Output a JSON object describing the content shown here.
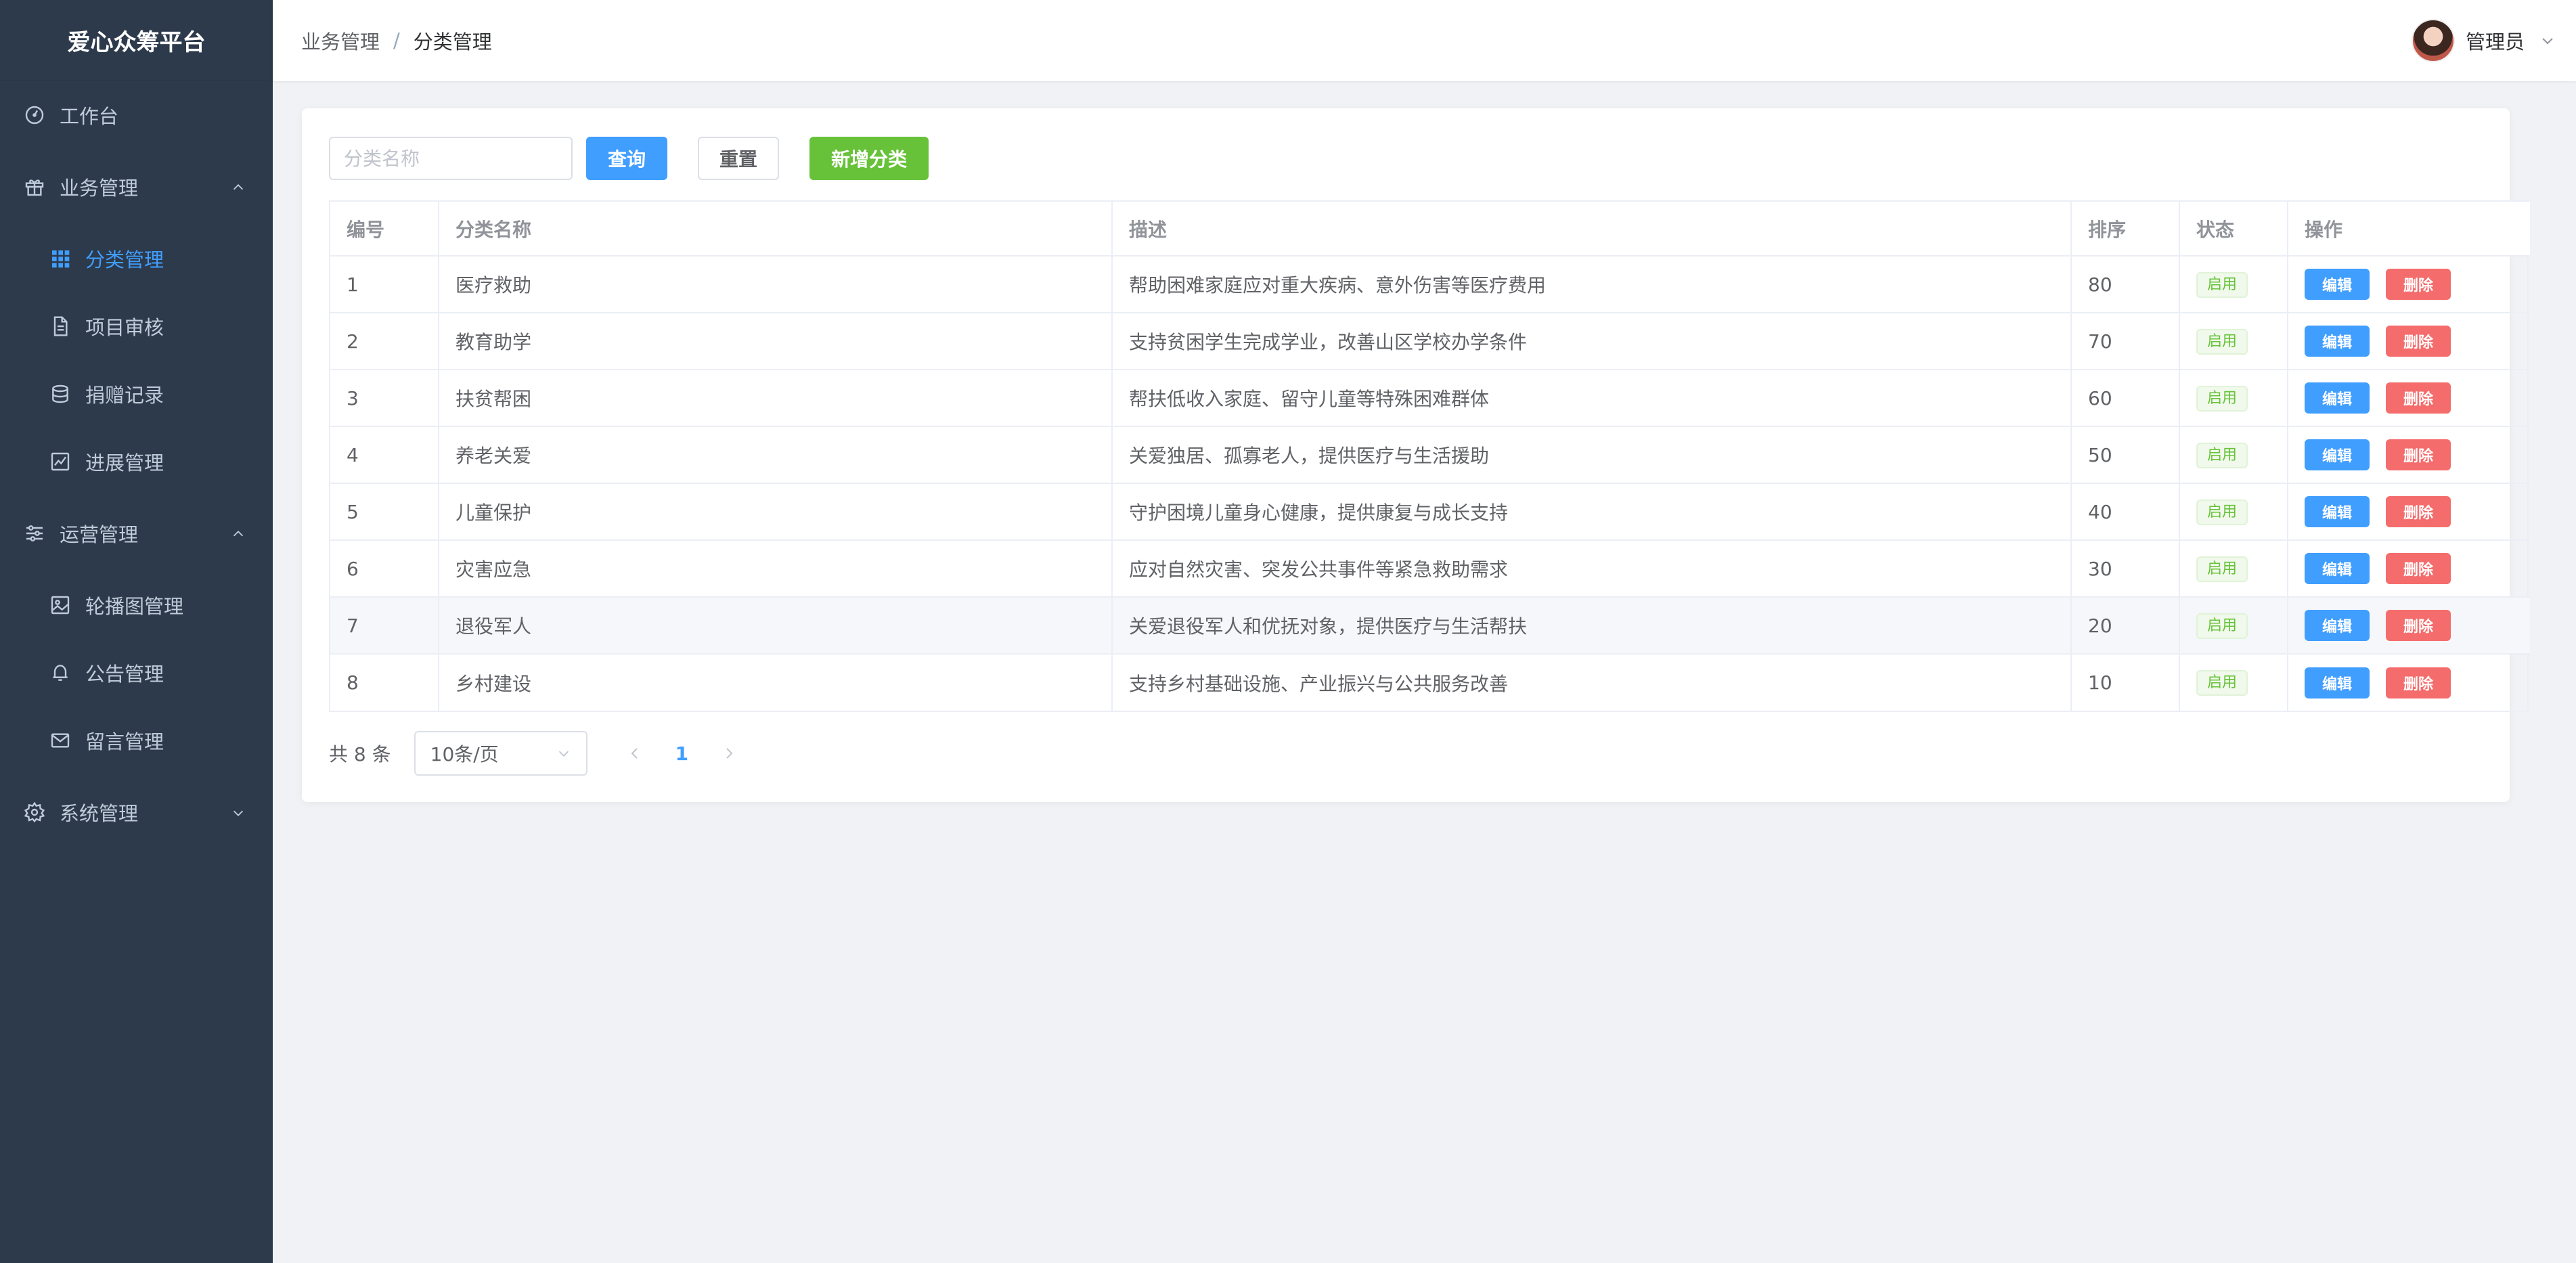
{
  "app": {
    "title": "爱心众筹平台"
  },
  "sidebar": {
    "items": [
      {
        "label": "工作台",
        "icon": "dashboard-icon"
      },
      {
        "label": "业务管理",
        "icon": "gift-icon",
        "expanded": true
      },
      {
        "label": "分类管理",
        "icon": "grid-icon",
        "active": true
      },
      {
        "label": "项目审核",
        "icon": "document-icon"
      },
      {
        "label": "捐赠记录",
        "icon": "coins-icon"
      },
      {
        "label": "进展管理",
        "icon": "chart-icon"
      },
      {
        "label": "运营管理",
        "icon": "sliders-icon",
        "expanded": true
      },
      {
        "label": "轮播图管理",
        "icon": "picture-icon"
      },
      {
        "label": "公告管理",
        "icon": "bell-icon"
      },
      {
        "label": "留言管理",
        "icon": "message-icon"
      },
      {
        "label": "系统管理",
        "icon": "gear-icon",
        "expanded": false
      }
    ]
  },
  "header": {
    "breadcrumb": [
      "业务管理",
      "分类管理"
    ],
    "separator": "/",
    "user": "管理员"
  },
  "toolbar": {
    "search_placeholder": "分类名称",
    "search_value": "",
    "query_label": "查询",
    "reset_label": "重置",
    "add_label": "新增分类"
  },
  "table": {
    "columns": [
      "编号",
      "分类名称",
      "描述",
      "排序",
      "状态",
      "操作"
    ],
    "edit_label": "编辑",
    "delete_label": "删除",
    "rows": [
      {
        "id": "1",
        "name": "医疗救助",
        "desc": "帮助困难家庭应对重大疾病、意外伤害等医疗费用",
        "sort": "80",
        "status": "启用"
      },
      {
        "id": "2",
        "name": "教育助学",
        "desc": "支持贫困学生完成学业，改善山区学校办学条件",
        "sort": "70",
        "status": "启用"
      },
      {
        "id": "3",
        "name": "扶贫帮困",
        "desc": "帮扶低收入家庭、留守儿童等特殊困难群体",
        "sort": "60",
        "status": "启用"
      },
      {
        "id": "4",
        "name": "养老关爱",
        "desc": "关爱独居、孤寡老人，提供医疗与生活援助",
        "sort": "50",
        "status": "启用"
      },
      {
        "id": "5",
        "name": "儿童保护",
        "desc": "守护困境儿童身心健康，提供康复与成长支持",
        "sort": "40",
        "status": "启用"
      },
      {
        "id": "6",
        "name": "灾害应急",
        "desc": "应对自然灾害、突发公共事件等紧急救助需求",
        "sort": "30",
        "status": "启用"
      },
      {
        "id": "7",
        "name": "退役军人",
        "desc": "关爱退役军人和优抚对象，提供医疗与生活帮扶",
        "sort": "20",
        "status": "启用"
      },
      {
        "id": "8",
        "name": "乡村建设",
        "desc": "支持乡村基础设施、产业振兴与公共服务改善",
        "sort": "10",
        "status": "启用"
      }
    ]
  },
  "pagination": {
    "total_text": "共 8 条",
    "page_size": "10条/页",
    "current_page": "1"
  },
  "colors": {
    "sidebar_bg": "#2d3a4b",
    "primary": "#409eff",
    "success": "#67c23a",
    "danger": "#f56c6c"
  }
}
